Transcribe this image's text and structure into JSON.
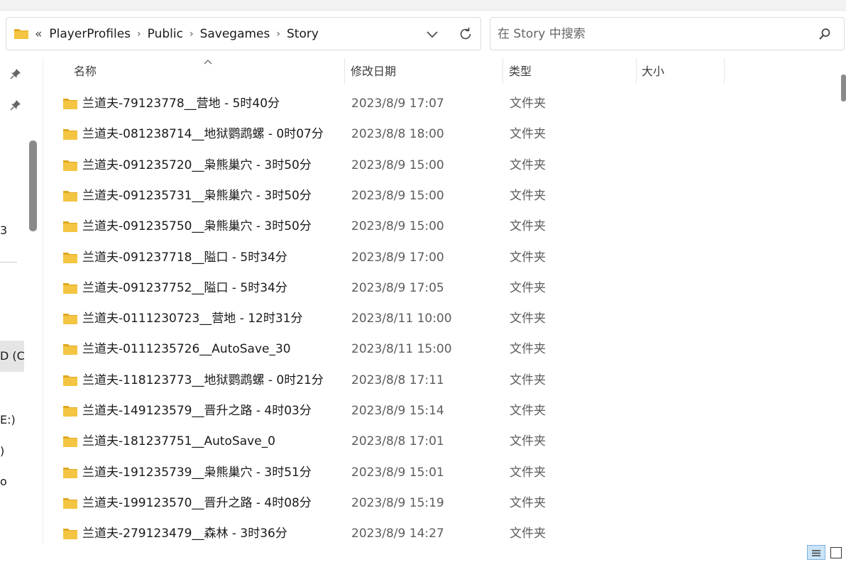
{
  "address": {
    "overflow": "«",
    "crumbs": [
      "PlayerProfiles",
      "Public",
      "Savegames",
      "Story"
    ]
  },
  "search": {
    "placeholder": "在 Story 中搜索"
  },
  "nav": {
    "fragments": [
      "3",
      "D (C",
      "E:)",
      ")",
      "o"
    ]
  },
  "columns": {
    "name": "名称",
    "date": "修改日期",
    "type": "类型",
    "size": "大小"
  },
  "files": [
    {
      "name": "兰道夫-79123778__营地 - 5时40分",
      "date": "2023/8/9 17:07",
      "type": "文件夹"
    },
    {
      "name": "兰道夫-081238714__地狱鹦鹉螺 - 0时07分",
      "date": "2023/8/8 18:00",
      "type": "文件夹"
    },
    {
      "name": "兰道夫-091235720__枭熊巢穴 - 3时50分",
      "date": "2023/8/9 15:00",
      "type": "文件夹"
    },
    {
      "name": "兰道夫-091235731__枭熊巢穴 - 3时50分",
      "date": "2023/8/9 15:00",
      "type": "文件夹"
    },
    {
      "name": "兰道夫-091235750__枭熊巢穴 - 3时50分",
      "date": "2023/8/9 15:00",
      "type": "文件夹"
    },
    {
      "name": "兰道夫-091237718__隘口 - 5时34分",
      "date": "2023/8/9 17:00",
      "type": "文件夹"
    },
    {
      "name": "兰道夫-091237752__隘口 - 5时34分",
      "date": "2023/8/9 17:05",
      "type": "文件夹"
    },
    {
      "name": "兰道夫-0111230723__营地 - 12时31分",
      "date": "2023/8/11 10:00",
      "type": "文件夹"
    },
    {
      "name": "兰道夫-0111235726__AutoSave_30",
      "date": "2023/8/11 15:00",
      "type": "文件夹"
    },
    {
      "name": "兰道夫-118123773__地狱鹦鹉螺 - 0时21分",
      "date": "2023/8/8 17:11",
      "type": "文件夹"
    },
    {
      "name": "兰道夫-149123579__晋升之路 - 4时03分",
      "date": "2023/8/9 15:14",
      "type": "文件夹"
    },
    {
      "name": "兰道夫-181237751__AutoSave_0",
      "date": "2023/8/8 17:01",
      "type": "文件夹"
    },
    {
      "name": "兰道夫-191235739__枭熊巢穴 - 3时51分",
      "date": "2023/8/9 15:01",
      "type": "文件夹"
    },
    {
      "name": "兰道夫-199123570__晋升之路 - 4时08分",
      "date": "2023/8/9 15:19",
      "type": "文件夹"
    },
    {
      "name": "兰道夫-279123479__森林 - 3时36分",
      "date": "2023/8/9 14:27",
      "type": "文件夹"
    }
  ],
  "icons": {
    "folder": "folder-icon",
    "pin": "pin-icon",
    "search": "search-icon",
    "refresh": "refresh-icon",
    "dropdown": "chevron-down-icon",
    "sort": "sort-up-icon"
  },
  "colors": {
    "folder": "#f4c542",
    "folder_dark": "#e0a820",
    "selection": "#cce4f7"
  }
}
